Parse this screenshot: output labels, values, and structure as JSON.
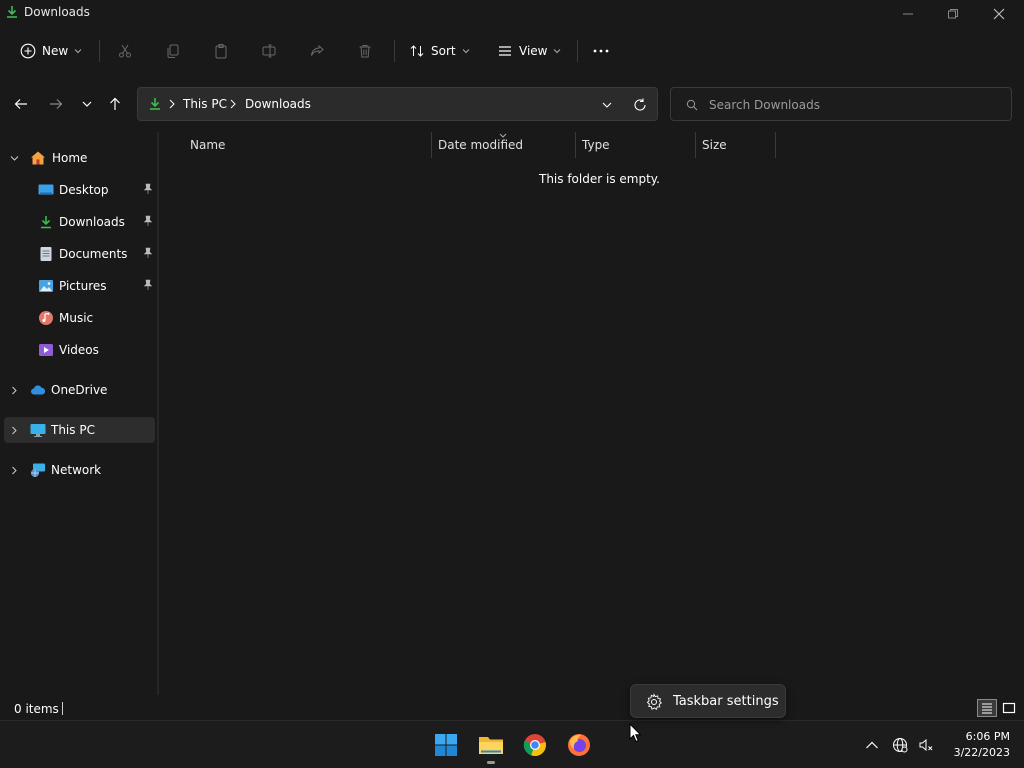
{
  "window": {
    "title": "Downloads"
  },
  "toolbar": {
    "new_label": "New",
    "sort_label": "Sort",
    "view_label": "View"
  },
  "address": {
    "crumbs": [
      "This PC",
      "Downloads"
    ]
  },
  "search": {
    "placeholder": "Search Downloads"
  },
  "sidebar": {
    "items": [
      {
        "label": "Home"
      },
      {
        "label": "Desktop"
      },
      {
        "label": "Downloads"
      },
      {
        "label": "Documents"
      },
      {
        "label": "Pictures"
      },
      {
        "label": "Music"
      },
      {
        "label": "Videos"
      },
      {
        "label": "OneDrive"
      },
      {
        "label": "This PC"
      },
      {
        "label": "Network"
      }
    ]
  },
  "columns": [
    "Name",
    "Date modified",
    "Type",
    "Size"
  ],
  "content": {
    "empty_message": "This folder is empty."
  },
  "status": {
    "item_count": "0 items"
  },
  "popup": {
    "label": "Taskbar settings"
  },
  "clock": {
    "time": "6:06 PM",
    "date": "3/22/2023"
  },
  "colors": {
    "accent": "#4cc2ff",
    "download_green": "#3fb950",
    "selected_bg": "#2d2d2d"
  }
}
